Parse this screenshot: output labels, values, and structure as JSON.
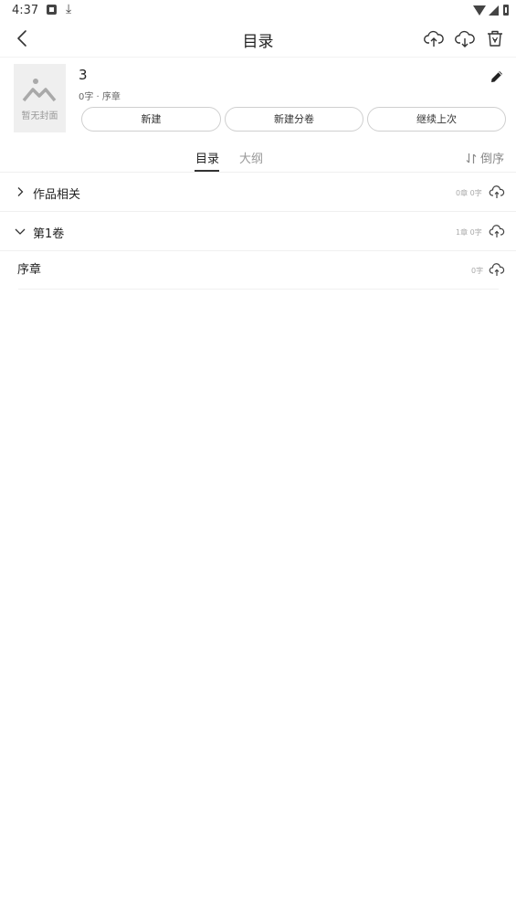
{
  "status_bar": {
    "time": "4:37"
  },
  "header": {
    "title": "目录"
  },
  "book": {
    "cover_label": "暂无封面",
    "title": "3",
    "meta": "0字 · 序章",
    "buttons": {
      "new": "新建",
      "new_volume": "新建分卷",
      "continue": "继续上次"
    }
  },
  "tabs": {
    "catalog": "目录",
    "outline": "大纲",
    "reverse": "倒序"
  },
  "list": {
    "rows": [
      {
        "label": "作品相关",
        "count": "0章 0字",
        "expanded": false
      },
      {
        "label": "第1卷",
        "count": "1章 0字",
        "expanded": true
      }
    ],
    "chapters": [
      {
        "label": "序章",
        "count": "0字"
      }
    ]
  },
  "icons": {
    "back": "back-arrow-icon",
    "upload": "cloud-upload-icon",
    "download": "cloud-download-icon",
    "delete": "trash-icon",
    "edit": "pencil-icon",
    "sort": "sort-icon"
  }
}
